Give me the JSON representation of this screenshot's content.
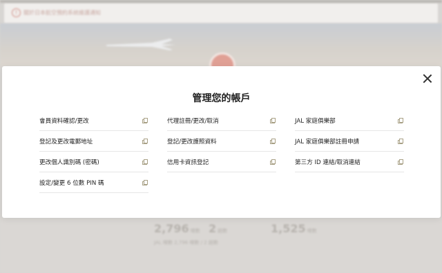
{
  "background": {
    "notice_text": "關於日本航空預約系統維護通知",
    "stats": {
      "miles_value": "2,796",
      "miles_unit": "哩數",
      "count_value": "2",
      "count_unit": "趟數",
      "points_value": "1,525",
      "points_unit": "哩數",
      "sub_line": "JAL 哩數 2,796 哩數 / 2 趟數"
    }
  },
  "modal": {
    "title": "管理您的帳戶",
    "columns": [
      {
        "items": [
          {
            "label": "會員資料確認/更改"
          },
          {
            "label": "登記及更改電郵地址"
          },
          {
            "label": "更改個人識別碼 (密碼)"
          },
          {
            "label": "設定/變更 6 位數 PIN 碼"
          }
        ]
      },
      {
        "items": [
          {
            "label": "代理註冊/更改/取消"
          },
          {
            "label": "登記/更改護照資料"
          },
          {
            "label": "信用卡資訊登記"
          }
        ]
      },
      {
        "items": [
          {
            "label": "JAL 家庭俱樂部"
          },
          {
            "label": "JAL 家庭俱樂部註冊申請"
          },
          {
            "label": "第三方 ID 連結/取消連結"
          }
        ]
      }
    ]
  }
}
